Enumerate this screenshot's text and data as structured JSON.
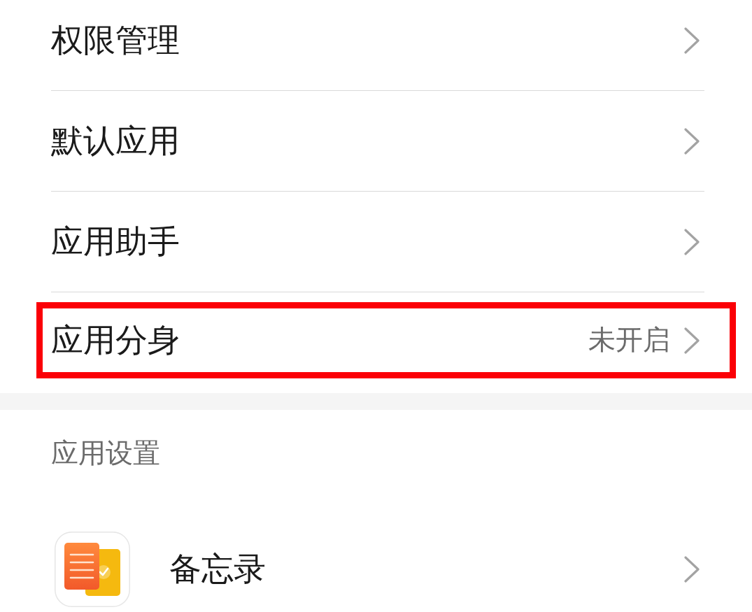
{
  "items": [
    {
      "label": "权限管理",
      "highlighted": false
    },
    {
      "label": "默认应用",
      "highlighted": false
    },
    {
      "label": "应用助手",
      "highlighted": false
    },
    {
      "label": "应用分身",
      "value": "未开启",
      "highlighted": true
    }
  ],
  "section": {
    "title": "应用设置"
  },
  "apps": [
    {
      "name": "备忘录"
    }
  ]
}
